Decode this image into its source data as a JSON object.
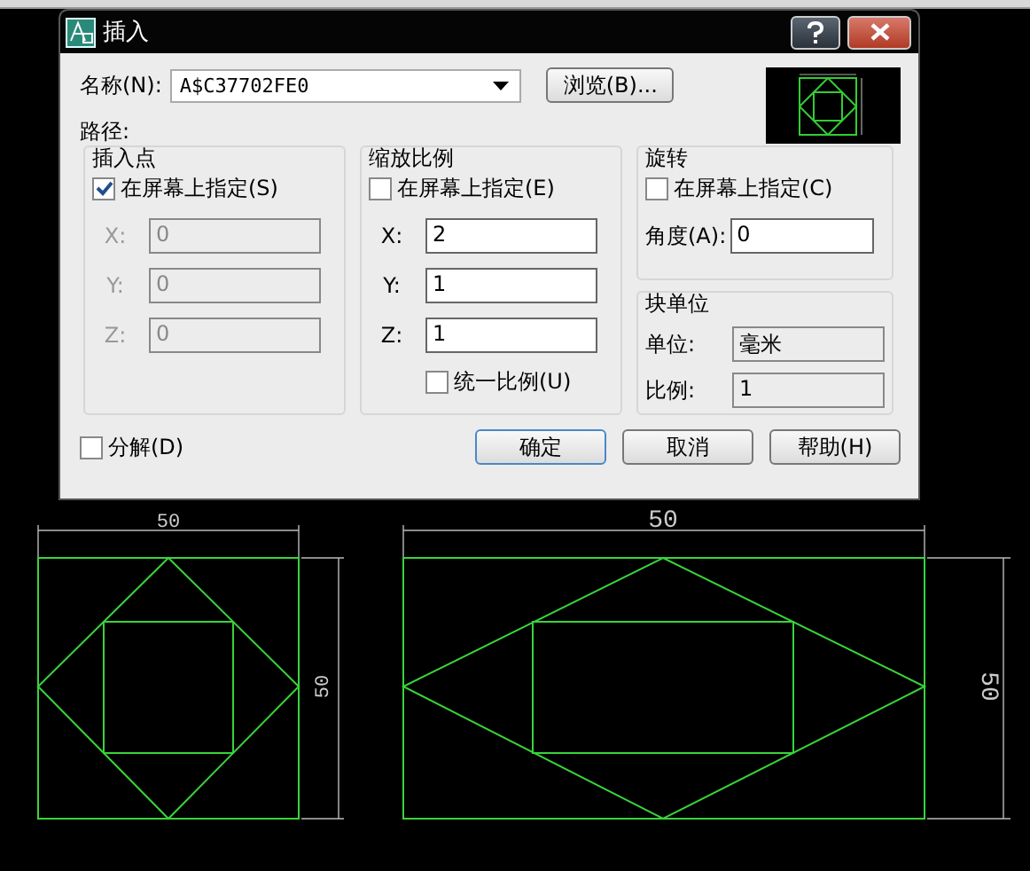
{
  "window": {
    "title": "插入"
  },
  "name": {
    "label": "名称(N):",
    "value": "A$C37702FE0"
  },
  "browse_button": "浏览(B)...",
  "path": {
    "label": "路径:"
  },
  "insertion_point": {
    "title": "插入点",
    "specify_on_screen": {
      "label": "在屏幕上指定(S)",
      "checked": true
    },
    "fields": [
      {
        "label": "X:",
        "value": "0",
        "disabled": true
      },
      {
        "label": "Y:",
        "value": "0",
        "disabled": true
      },
      {
        "label": "Z:",
        "value": "0",
        "disabled": true
      }
    ]
  },
  "scale": {
    "title": "缩放比例",
    "specify_on_screen": {
      "label": "在屏幕上指定(E)",
      "checked": false
    },
    "fields": [
      {
        "label": "X:",
        "value": "2",
        "disabled": false
      },
      {
        "label": "Y:",
        "value": "1",
        "disabled": false
      },
      {
        "label": "Z:",
        "value": "1",
        "disabled": false
      }
    ],
    "uniform": {
      "label": "统一比例(U)",
      "checked": false
    }
  },
  "rotation": {
    "title": "旋转",
    "specify_on_screen": {
      "label": "在屏幕上指定(C)",
      "checked": false
    },
    "angle": {
      "label": "角度(A):",
      "value": "0"
    }
  },
  "block_unit": {
    "title": "块单位",
    "unit": {
      "label": "单位:",
      "value": "毫米"
    },
    "factor": {
      "label": "比例:",
      "value": "1"
    }
  },
  "explode": {
    "label": "分解(D)",
    "checked": false
  },
  "buttons": [
    "确定",
    "取消",
    "帮助(H)"
  ],
  "drawing": {
    "dimension_labels": [
      "50",
      "50",
      "50",
      "50"
    ]
  }
}
